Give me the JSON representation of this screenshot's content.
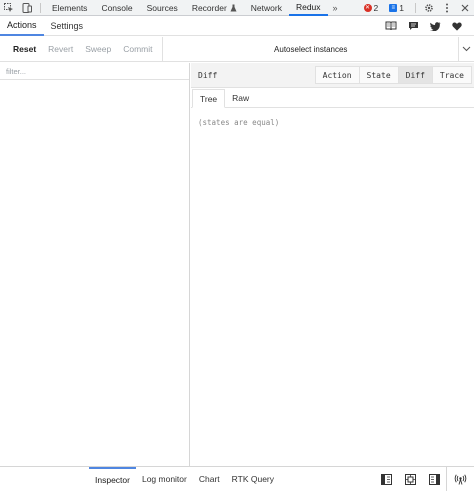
{
  "devtools": {
    "tabs": [
      {
        "label": "Elements"
      },
      {
        "label": "Console"
      },
      {
        "label": "Sources"
      },
      {
        "label": "Recorder"
      },
      {
        "label": "Network"
      },
      {
        "label": "Redux"
      }
    ],
    "active_tab": "Redux",
    "more": "»",
    "error_count": "2",
    "message_count": "1",
    "icons": [
      "inspect-icon",
      "device-toggle-icon",
      "recorder-flask-icon",
      "error-icon",
      "message-icon",
      "gear-icon",
      "kebab-menu-icon"
    ]
  },
  "redux": {
    "tabs": [
      {
        "label": "Actions"
      },
      {
        "label": "Settings"
      }
    ],
    "active_tab": "Actions",
    "header_icons": [
      "book-icon",
      "chat-icon",
      "twitter-icon",
      "heart-icon"
    ]
  },
  "controls": {
    "reset": "Reset",
    "revert": "Revert",
    "sweep": "Sweep",
    "commit": "Commit",
    "instances": "Autoselect instances"
  },
  "filter": {
    "placeholder": "filter...",
    "value": ""
  },
  "inspector": {
    "title": "Diff",
    "mode_buttons": [
      {
        "label": "Action"
      },
      {
        "label": "State"
      },
      {
        "label": "Diff"
      },
      {
        "label": "Trace"
      }
    ],
    "active_mode": "Diff",
    "subtabs": [
      {
        "label": "Tree"
      },
      {
        "label": "Raw"
      }
    ],
    "active_subtab": "Tree",
    "message": "(states are equal)"
  },
  "monitors": {
    "tabs": [
      {
        "label": "Inspector"
      },
      {
        "label": "Log monitor"
      },
      {
        "label": "Chart"
      },
      {
        "label": "RTK Query"
      }
    ],
    "active": "Inspector",
    "icons": [
      "dock-left-icon",
      "dock-center-icon",
      "dock-right-icon",
      "remote-antenna-icon"
    ]
  },
  "colors": {
    "accent": "#1a73e8",
    "tab_underline": "#4f86e1",
    "error": "#d93025"
  }
}
